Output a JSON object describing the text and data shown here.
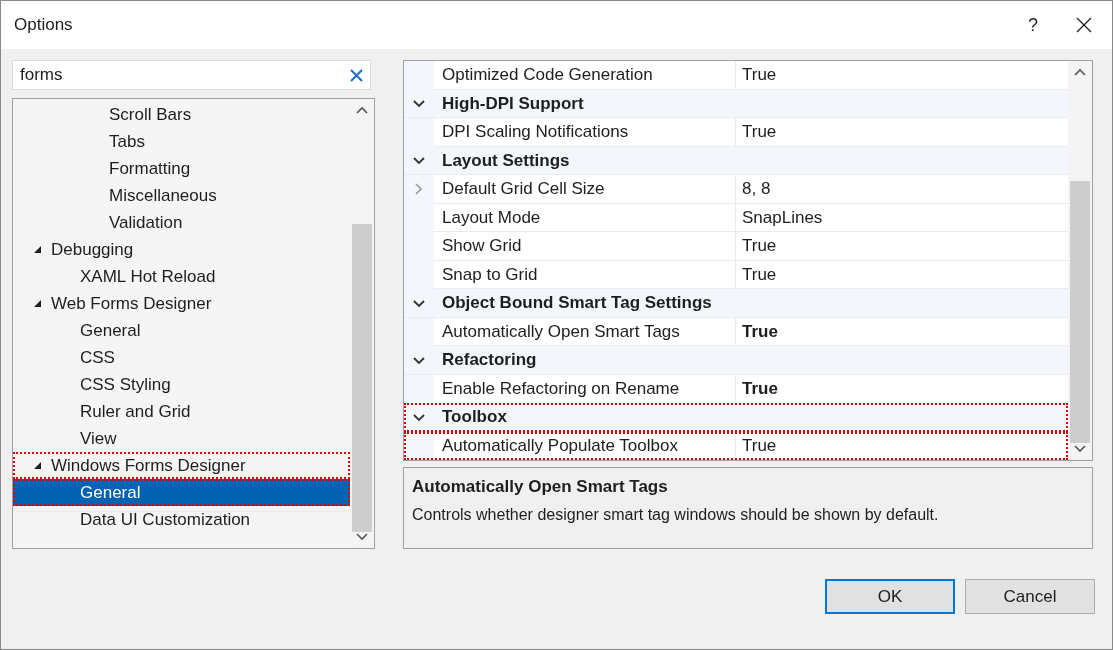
{
  "window": {
    "title": "Options",
    "help_glyph": "?"
  },
  "search": {
    "value": "forms"
  },
  "tree": {
    "continued_items": [
      {
        "label": "Scroll Bars",
        "selected": false
      },
      {
        "label": "Tabs",
        "selected": false
      },
      {
        "label": "Formatting",
        "selected": false
      },
      {
        "label": "Miscellaneous",
        "selected": false
      },
      {
        "label": "Validation",
        "selected": false
      }
    ],
    "items": [
      {
        "label": "Debugging",
        "expanded": true,
        "selected": false,
        "highlighted": false,
        "children": [
          {
            "label": "XAML Hot Reload",
            "selected": false,
            "highlighted": false
          }
        ]
      },
      {
        "label": "Web Forms Designer",
        "expanded": true,
        "selected": false,
        "highlighted": false,
        "children": [
          {
            "label": "General",
            "selected": false,
            "highlighted": false
          },
          {
            "label": "CSS",
            "selected": false,
            "highlighted": false
          },
          {
            "label": "CSS Styling",
            "selected": false,
            "highlighted": false
          },
          {
            "label": "Ruler and Grid",
            "selected": false,
            "highlighted": false
          },
          {
            "label": "View",
            "selected": false,
            "highlighted": false
          }
        ]
      },
      {
        "label": "Windows Forms Designer",
        "expanded": true,
        "selected": false,
        "highlighted": true,
        "children": [
          {
            "label": "General",
            "selected": true,
            "highlighted": true
          },
          {
            "label": "Data UI Customization",
            "selected": false,
            "highlighted": false
          }
        ]
      }
    ]
  },
  "property_grid": {
    "rows": [
      {
        "kind": "property",
        "name": "Optimized Code Generation",
        "value": "True",
        "value_bold": false,
        "expandable": false,
        "highlighted": false
      },
      {
        "kind": "category",
        "name": "High-DPI Support",
        "expanded": true,
        "highlighted": false
      },
      {
        "kind": "property",
        "name": "DPI Scaling Notifications",
        "value": "True",
        "value_bold": false,
        "expandable": false,
        "highlighted": false
      },
      {
        "kind": "category",
        "name": "Layout Settings",
        "expanded": true,
        "highlighted": false
      },
      {
        "kind": "property",
        "name": "Default Grid Cell Size",
        "value": "8, 8",
        "value_bold": false,
        "expandable": true,
        "highlighted": false
      },
      {
        "kind": "property",
        "name": "Layout Mode",
        "value": "SnapLines",
        "value_bold": false,
        "expandable": false,
        "highlighted": false
      },
      {
        "kind": "property",
        "name": "Show Grid",
        "value": "True",
        "value_bold": false,
        "expandable": false,
        "highlighted": false
      },
      {
        "kind": "property",
        "name": "Snap to Grid",
        "value": "True",
        "value_bold": false,
        "expandable": false,
        "highlighted": false
      },
      {
        "kind": "category",
        "name": "Object Bound Smart Tag Settings",
        "expanded": true,
        "highlighted": false
      },
      {
        "kind": "property",
        "name": "Automatically Open Smart Tags",
        "value": "True",
        "value_bold": true,
        "expandable": false,
        "highlighted": false
      },
      {
        "kind": "category",
        "name": "Refactoring",
        "expanded": true,
        "highlighted": false
      },
      {
        "kind": "property",
        "name": "Enable Refactoring on Rename",
        "value": "True",
        "value_bold": true,
        "expandable": false,
        "highlighted": false
      },
      {
        "kind": "category",
        "name": "Toolbox",
        "expanded": true,
        "highlighted": true
      },
      {
        "kind": "property",
        "name": "Automatically Populate Toolbox",
        "value": "True",
        "value_bold": false,
        "expandable": false,
        "highlighted": true
      }
    ]
  },
  "description": {
    "title": "Automatically Open Smart Tags",
    "text": "Controls whether designer smart tag windows should be shown by default."
  },
  "buttons": [
    {
      "label": "OK",
      "default": true
    },
    {
      "label": "Cancel",
      "default": false
    }
  ]
}
